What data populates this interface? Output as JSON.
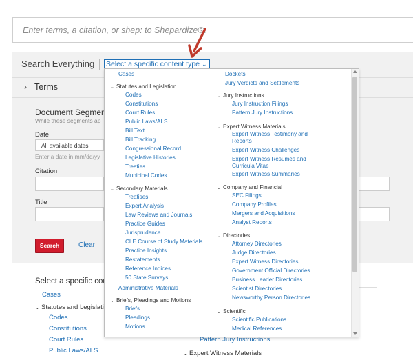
{
  "search": {
    "placeholder": "Enter terms, a citation, or shep: to Shepardize®."
  },
  "panel": {
    "title": "Search Everything",
    "content_type_link": "Select a specific content type",
    "terms_label": "Terms",
    "segments_title": "Document Segment",
    "segments_desc": "While these segments ap",
    "date_label": "Date",
    "date_value": "All available dates",
    "date_hint": "Enter a date in mm/dd/yy",
    "citation_label": "Citation",
    "title_label": "Title",
    "search_button": "Search",
    "clear_link": "Clear"
  },
  "below": {
    "title": "Select a specific con",
    "cases": "Cases",
    "statutes_head": "Statutes and Legislatio",
    "codes": "Codes",
    "constitutions": "Constitutions",
    "court_rules": "Court Rules",
    "public_laws": "Public Laws/ALS",
    "pattern_jury": "Pattern Jury Instructions",
    "expert_head": "Expert Witness Materials"
  },
  "dropdown": {
    "left": {
      "cases": "Cases",
      "statutes_head": "Statutes and Legislation",
      "statutes": [
        "Codes",
        "Constitutions",
        "Court Rules",
        "Public Laws/ALS",
        "Bill Text",
        "Bill Tracking",
        "Congressional Record",
        "Legislative Histories",
        "Treaties",
        "Municipal Codes"
      ],
      "secondary_head": "Secondary Materials",
      "secondary": [
        "Treatises",
        "Expert Analysis",
        "Law Reviews and Journals",
        "Practice Guides",
        "Jurisprudence",
        "CLE Course of Study Materials",
        "Practice Insights",
        "Restatements",
        "Reference Indices",
        "50 State Surveys"
      ],
      "admin": "Administrative Materials",
      "briefs_head": "Briefs, Pleadings and Motions",
      "briefs": [
        "Briefs",
        "Pleadings",
        "Motions"
      ]
    },
    "right": {
      "dockets": "Dockets",
      "jury_verdicts": "Jury Verdicts and Settlements",
      "jury_head": "Jury Instructions",
      "jury": [
        "Jury Instruction Filings",
        "Pattern Jury Instructions"
      ],
      "expert_head": "Expert Witness Materials",
      "expert": [
        "Expert Witness Testimony and Reports",
        "Expert Witness Challenges",
        "Expert Witness Resumes and Curricula Vitae",
        "Expert Witness Summaries"
      ],
      "company_head": "Company and Financial",
      "company": [
        "SEC Filings",
        "Company Profiles",
        "Mergers and Acquisitions",
        "Analyst Reports"
      ],
      "directories_head": "Directories",
      "directories": [
        "Attorney Directories",
        "Judge Directories",
        "Expert Witness Directories",
        "Government Official Directories",
        "Business Leader Directories",
        "Scientist Directories",
        "Newsworthy Person Directories"
      ],
      "scientific_head": "Scientific",
      "scientific": [
        "Scientific Publications",
        "Medical References"
      ]
    }
  },
  "colors": {
    "link": "#1f6fb5",
    "search_button": "#d11d2d",
    "arrow": "#c0392b",
    "panel_bg": "#f1f1f1"
  }
}
